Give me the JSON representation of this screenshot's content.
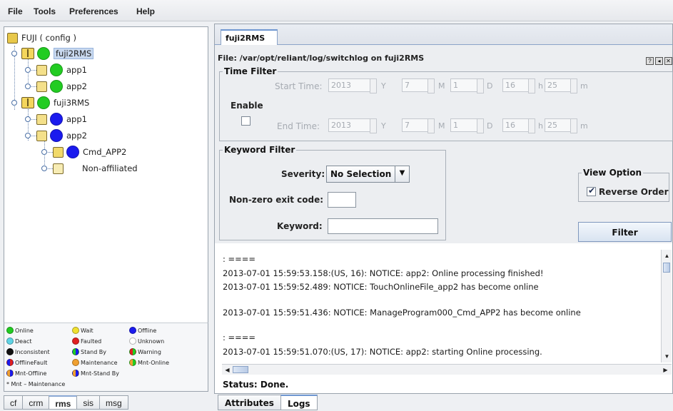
{
  "menu": [
    "File",
    "Tools",
    "Preferences",
    "Help"
  ],
  "tree": {
    "root": "FUJI ( config )",
    "nodes": [
      {
        "label": "fuji2RMS",
        "color": "#22cc22"
      },
      {
        "label": "app1",
        "color": "#22cc22"
      },
      {
        "label": "app2",
        "color": "#22cc22"
      },
      {
        "label": "fuji3RMS",
        "color": "#22cc22"
      },
      {
        "label": "app1",
        "color": "#1a1aee"
      },
      {
        "label": "app2",
        "color": "#1a1aee"
      },
      {
        "label": "Cmd_APP2",
        "color": "#1a1aee"
      },
      {
        "label": "Non-affiliated",
        "color": ""
      }
    ]
  },
  "legend": {
    "items": [
      {
        "label": "Online",
        "a": "#22cc22",
        "b": "#22cc22"
      },
      {
        "label": "Wait",
        "a": "#f0e030",
        "b": "#f0e030"
      },
      {
        "label": "Offline",
        "a": "#1a1aee",
        "b": "#1a1aee"
      },
      {
        "label": "Deact",
        "a": "#5fd4e6",
        "b": "#5fd4e6"
      },
      {
        "label": "Faulted",
        "a": "#e02020",
        "b": "#e02020"
      },
      {
        "label": "Unknown",
        "a": "#ffffff",
        "b": "#ffffff"
      },
      {
        "label": "Inconsistent",
        "a": "#111111",
        "b": "#111111"
      },
      {
        "label": "Stand By",
        "a": "#22cc22",
        "b": "#1a1aee"
      },
      {
        "label": "Warning",
        "a": "#e02020",
        "b": "#22cc22"
      },
      {
        "label": "OfflineFault",
        "a": "#1a1aee",
        "b": "#e02020"
      },
      {
        "label": "Maintenance",
        "a": "#f0a030",
        "b": "#f0a030"
      },
      {
        "label": "Mnt-Online",
        "a": "#f0a030",
        "b": "#22cc22"
      },
      {
        "label": "Mnt-Offline",
        "a": "#f0a030",
        "b": "#1a1aee"
      },
      {
        "label": "Mnt-Stand By",
        "a": "#f0a030",
        "b": "#1a1aee"
      }
    ],
    "note": "* Mnt – Maintenance"
  },
  "left_tabs": [
    "cf",
    "crm",
    "rms",
    "sis",
    "msg"
  ],
  "right": {
    "tab": "fuji2RMS",
    "file_header": "File: /var/opt/reliant/log/switchlog on fuji2RMS",
    "time_filter": {
      "legend": "Time Filter",
      "enable_label": "Enable",
      "start_label": "Start Time:",
      "end_label": "End Time:",
      "start": {
        "year": "2013",
        "month": "7",
        "day": "1",
        "hour": "16",
        "minute": "25"
      },
      "end": {
        "year": "2013",
        "month": "7",
        "day": "1",
        "hour": "16",
        "minute": "25"
      },
      "units": {
        "y": "Y",
        "m": "M",
        "d": "D",
        "h": "h",
        "min": "m"
      }
    },
    "keyword_filter": {
      "legend": "Keyword Filter",
      "severity_label": "Severity:",
      "severity_value": "No Selection",
      "exit_label": "Non-zero exit code:",
      "keyword_label": "Keyword:"
    },
    "view_option": {
      "legend": "View Option",
      "reverse_label": "Reverse Order"
    },
    "filter_button": "Filter",
    "log_lines": [
      ": ====",
      "2013-07-01 15:59:53.158:(US, 16): NOTICE: app2: Online processing finished!",
      "2013-07-01 15:59:52.489: NOTICE: TouchOnlineFile_app2 has become online",
      "2013-07-01 15:59:51.436: NOTICE: ManageProgram000_Cmd_APP2 has become online",
      ": ====",
      "2013-07-01 15:59:51.070:(US, 17): NOTICE: app2: starting Online processing."
    ],
    "status": "Status: Done.",
    "bottom_tabs": [
      "Attributes",
      "Logs"
    ]
  }
}
